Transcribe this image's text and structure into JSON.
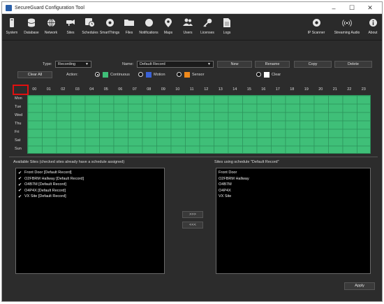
{
  "window": {
    "title": "SecureGuard Configuration Tool",
    "controls": [
      "–",
      "☐",
      "✕"
    ]
  },
  "toolbar": [
    {
      "label": "System",
      "icon": "system-icon"
    },
    {
      "label": "Database",
      "icon": "database-icon"
    },
    {
      "label": "Network",
      "icon": "network-icon"
    },
    {
      "label": "Sites",
      "icon": "sites-icon"
    },
    {
      "label": "Schedules",
      "icon": "schedules-icon"
    },
    {
      "label": "SmartThings",
      "icon": "smartthings-icon"
    },
    {
      "label": "Files",
      "icon": "files-icon"
    },
    {
      "label": "Notifications",
      "icon": "notifications-icon"
    },
    {
      "label": "Maps",
      "icon": "maps-icon"
    },
    {
      "label": "Users",
      "icon": "users-icon"
    },
    {
      "label": "Licenses",
      "icon": "licenses-icon"
    },
    {
      "label": "Logs",
      "icon": "logs-icon"
    },
    {
      "label": "IP Scanner",
      "icon": "ip-scanner-icon"
    },
    {
      "label": "Streaming Audio",
      "icon": "streaming-audio-icon"
    },
    {
      "label": "About",
      "icon": "about-icon"
    }
  ],
  "controls": {
    "type_label": "Type:",
    "type_value": "Recording",
    "name_label": "Name:",
    "name_value": "Default Record",
    "new": "New",
    "rename": "Rename",
    "copy": "Copy",
    "delete": "Delete",
    "clear_all": "Clear All",
    "action_label": "Action:",
    "actions": [
      {
        "label": "Continuous",
        "color": "#3fbf78",
        "selected": true
      },
      {
        "label": "Motion",
        "color": "#3a62d8",
        "selected": false
      },
      {
        "label": "Sensor",
        "color": "#f08a1c",
        "selected": false
      },
      {
        "label": "Clear",
        "color": "#ffffff",
        "selected": false
      }
    ]
  },
  "schedule": {
    "hours": [
      "00",
      "01",
      "02",
      "03",
      "04",
      "05",
      "06",
      "07",
      "08",
      "09",
      "10",
      "11",
      "12",
      "13",
      "14",
      "15",
      "16",
      "17",
      "18",
      "19",
      "20",
      "21",
      "22",
      "23"
    ],
    "days": [
      "Mon",
      "Tue",
      "Wed",
      "Thu",
      "Fri",
      "Sat",
      "Sun"
    ],
    "fill_action": "Continuous",
    "fill_color": "#3fbf78"
  },
  "available_sites": {
    "title": "Available Sites (checked sites already have a schedule assigned)",
    "items": [
      {
        "label": "Front Door [Default Record]",
        "checked": true
      },
      {
        "label": "O2FBRM Hallway [Default Record]",
        "checked": true
      },
      {
        "label": "O4B7M [Default Record]",
        "checked": true
      },
      {
        "label": "O4P4X [Default Record]",
        "checked": true
      },
      {
        "label": "VX Site [Default Record]",
        "checked": true
      }
    ]
  },
  "move": {
    "add": ">>>",
    "remove": "<<<"
  },
  "assigned_sites": {
    "title": "Sites using schedule \"Default Record\"",
    "items": [
      "Front Door",
      "O2FBRM Hallway",
      "O4B7M",
      "O4P4X",
      "VX Site"
    ]
  },
  "apply": "Apply"
}
